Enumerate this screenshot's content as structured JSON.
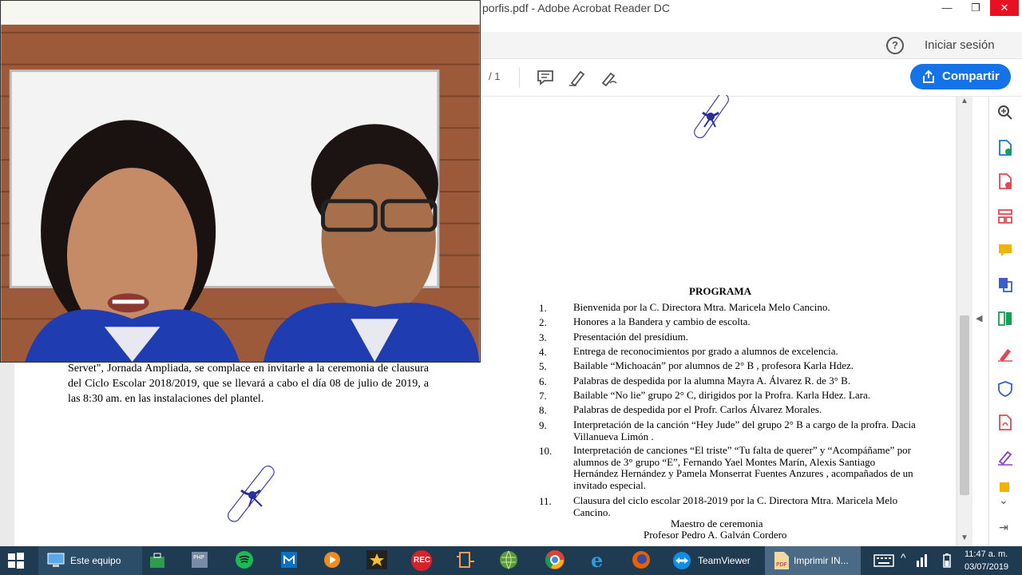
{
  "window": {
    "title": "porfis.pdf - Adobe Acrobat Reader DC",
    "minimize_glyph": "—",
    "restore_glyph": "❐",
    "close_glyph": "✕"
  },
  "menubar": {
    "help_glyph": "?",
    "signin_label": "Iniciar sesión"
  },
  "toolbar": {
    "page_count": "/ 1",
    "share_label": "Compartir"
  },
  "document": {
    "left_paragraph": "Servet\", Jornada Ampliada, se complace en invitarle a la  ceremonia de clausura del Ciclo Escolar 2018/2019, que se  llevará a cabo el día 08 de julio de 2019, a las 8:30 am. en las instalaciones del plantel.",
    "program_title": "PROGRAMA",
    "program_items": [
      {
        "num": "1.",
        "text": "Bienvenida  por la C. Directora Mtra. Maricela Melo Cancino."
      },
      {
        "num": "2.",
        "text": "Honores a la Bandera y cambio de escolta."
      },
      {
        "num": "3.",
        "text": "Presentación del presídium."
      },
      {
        "num": "4.",
        "text": "Entrega de reconocimientos por grado a alumnos de excelencia."
      },
      {
        "num": "5.",
        "text": "Bailable “Michoacán” por alumnos de 2° B , profesora Karla Hdez."
      },
      {
        "num": "6.",
        "text": "Palabras de despedida por la alumna Mayra  A. Álvarez R. de 3° B."
      },
      {
        "num": "7.",
        "text": "Bailable “No lie”  grupo 2° C, dirigidos por la Profra. Karla Hdez. Lara."
      },
      {
        "num": "8.",
        "text": "Palabras de despedida por el Profr. Carlos Álvarez Morales."
      },
      {
        "num": "9.",
        "text": "Interpretación de la canción “Hey Jude”  del  grupo 2° B a cargo de la profra. Dacia  Villanueva Limón ."
      },
      {
        "num": "10.",
        "text": "Interpretación de canciones “El triste” “Tu falta de querer” y “Acompáñame” por alumnos de 3° grupo “E”, Fernando Yael Montes Marín, Alexis Santiago Hernández Hernández y Pamela Monserrat Fuentes Anzures , acompañados de un invitado especial."
      },
      {
        "num": "11.",
        "text": "Clausura del ciclo escolar 2018-2019 por la C. Directora Mtra. Maricela Melo Cancino."
      }
    ],
    "mc_role": "Maestro de ceremonia",
    "mc_name": "Profesor Pedro A. Galván Cordero"
  },
  "taskbar": {
    "explorer_label": "Este equipo",
    "rec_label": "REC",
    "teamviewer_label": "TeamViewer",
    "acrobat_label": "Imprimir IN...",
    "clock_time": "11:47 a. m.",
    "clock_date": "03/07/2019"
  },
  "colors": {
    "accent": "#1473e6",
    "taskbar": "#1e3b52",
    "scroll_icon": "#3a3fb3"
  }
}
